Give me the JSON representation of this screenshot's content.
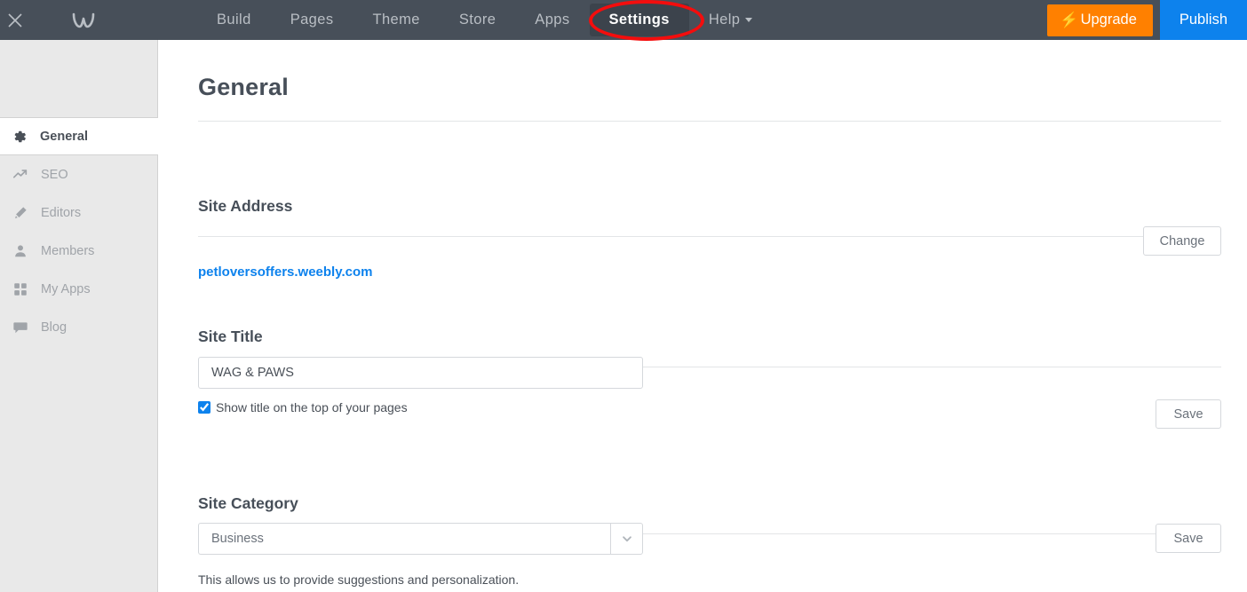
{
  "topbar": {
    "close_icon": "close-icon",
    "logo_icon": "weebly-logo-icon",
    "tabs": [
      {
        "label": "Build",
        "active": false,
        "has_caret": false
      },
      {
        "label": "Pages",
        "active": false,
        "has_caret": false
      },
      {
        "label": "Theme",
        "active": false,
        "has_caret": false
      },
      {
        "label": "Store",
        "active": false,
        "has_caret": false
      },
      {
        "label": "Apps",
        "active": false,
        "has_caret": false
      },
      {
        "label": "Settings",
        "active": true,
        "has_caret": false
      },
      {
        "label": "Help",
        "active": false,
        "has_caret": true
      }
    ],
    "upgrade_label": "Upgrade",
    "upgrade_icon": "lightning-bolt-icon",
    "publish_label": "Publish",
    "colors": {
      "bar_bg": "#474f59",
      "active_tab_bg": "#3c434c",
      "upgrade_bg": "#ff8000",
      "publish_bg": "#0d82ed",
      "highlight_ring": "#f40d0d"
    }
  },
  "sidebar": {
    "items": [
      {
        "label": "General",
        "icon": "gear-icon",
        "active": true
      },
      {
        "label": "SEO",
        "icon": "trending-up-icon",
        "active": false
      },
      {
        "label": "Editors",
        "icon": "pencil-icon",
        "active": false
      },
      {
        "label": "Members",
        "icon": "person-icon",
        "active": false
      },
      {
        "label": "My Apps",
        "icon": "grid-icon",
        "active": false
      },
      {
        "label": "Blog",
        "icon": "chat-bubble-icon",
        "active": false
      }
    ]
  },
  "main": {
    "page_title": "General",
    "site_address": {
      "heading": "Site Address",
      "url": "petloversoffers.weebly.com",
      "change_label": "Change"
    },
    "site_title": {
      "heading": "Site Title",
      "value": "WAG & PAWS",
      "placeholder": "Site Title",
      "checkbox_label": "Show title on the top of your pages",
      "checkbox_checked": true,
      "save_label": "Save"
    },
    "site_category": {
      "heading": "Site Category",
      "selected": "Business",
      "dropdown_icon": "chevron-down-icon",
      "helper_text": "This allows us to provide suggestions and personalization.",
      "save_label": "Save"
    }
  }
}
